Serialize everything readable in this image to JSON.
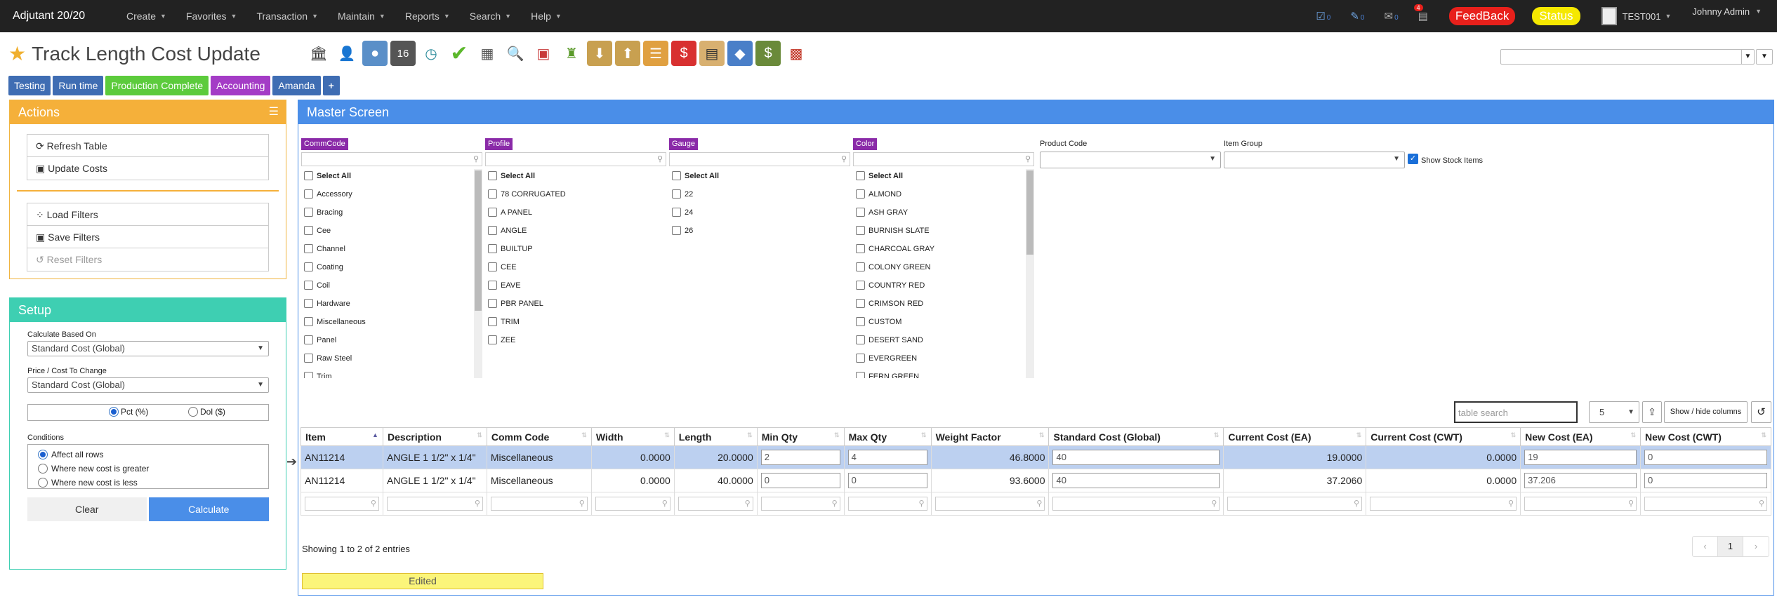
{
  "app": {
    "title": "Adjutant 20/20"
  },
  "topnav": {
    "menus": [
      "Create",
      "Favorites",
      "Transaction",
      "Maintain",
      "Reports",
      "Search",
      "Help"
    ],
    "tasks_count": "0",
    "edits_count": "0",
    "mail_count": "0",
    "alerts_badge": "4",
    "feedback_label": "FeedBack",
    "status_label": "Status",
    "company": "TEST001",
    "user": "Johnny Admin"
  },
  "page": {
    "title": "Track Length Cost Update"
  },
  "tabs": [
    {
      "label": "Testing",
      "color": "#3f6db3"
    },
    {
      "label": "Run time",
      "color": "#3f6db3"
    },
    {
      "label": "Production Complete",
      "color": "#5ccb3c"
    },
    {
      "label": "Accounting",
      "color": "#a43cc6"
    },
    {
      "label": "Amanda",
      "color": "#3f6db3"
    },
    {
      "label": "+",
      "color": "#3f6db3"
    }
  ],
  "actions": {
    "title": "Actions",
    "buttons": [
      "Refresh Table",
      "Update Costs"
    ],
    "filter_buttons": [
      "Load Filters",
      "Save Filters",
      "Reset Filters"
    ]
  },
  "setup": {
    "title": "Setup",
    "calc_label": "Calculate Based On",
    "calc_value": "Standard Cost (Global)",
    "price_label": "Price / Cost To Change",
    "price_value": "Standard Cost (Global)",
    "pct_label": "Pct (%)",
    "dol_label": "Dol ($)",
    "conditions_label": "Conditions",
    "conditions": [
      "Affect all rows",
      "Where new cost is greater",
      "Where new cost is less"
    ],
    "clear_label": "Clear",
    "calculate_label": "Calculate"
  },
  "master": {
    "title": "Master Screen",
    "filters": [
      {
        "label": "CommCode",
        "items": [
          "Select All",
          "Accessory",
          "Bracing",
          "Cee",
          "Channel",
          "Coating",
          "Coil",
          "Hardware",
          "Miscellaneous",
          "Panel",
          "Raw Steel",
          "Trim"
        ]
      },
      {
        "label": "Profile",
        "items": [
          "Select All",
          "78 CORRUGATED",
          "A PANEL",
          "ANGLE",
          "BUILTUP",
          "CEE",
          "EAVE",
          "PBR PANEL",
          "TRIM",
          "ZEE"
        ]
      },
      {
        "label": "Gauge",
        "items": [
          "Select All",
          "22",
          "24",
          "26"
        ]
      },
      {
        "label": "Color",
        "items": [
          "Select All",
          "ALMOND",
          "ASH GRAY",
          "BURNISH SLATE",
          "CHARCOAL GRAY",
          "COLONY GREEN",
          "COUNTRY RED",
          "CRIMSON RED",
          "CUSTOM",
          "DESERT SAND",
          "EVERGREEN",
          "FERN GREEN"
        ]
      }
    ],
    "product_code_label": "Product Code",
    "item_group_label": "Item Group",
    "show_stock_label": "Show Stock Items",
    "table_search_placeholder": "table search",
    "page_size": "5",
    "show_hide_label": "Show / hide columns",
    "columns": [
      "Item",
      "Description",
      "Comm Code",
      "Width",
      "Length",
      "Min Qty",
      "Max Qty",
      "Weight Factor",
      "Standard Cost (Global)",
      "Current Cost (EA)",
      "Current Cost (CWT)",
      "New Cost (EA)",
      "New Cost (CWT)"
    ],
    "rows": [
      {
        "item": "AN11214",
        "description": "ANGLE 1 1/2\" x 1/4\"",
        "comm_code": "Miscellaneous",
        "width": "0.0000",
        "length": "20.0000",
        "min_qty": "2",
        "max_qty": "4",
        "weight_factor": "46.8000",
        "std_cost": "40",
        "cur_ea": "19.0000",
        "cur_cwt": "0.0000",
        "new_ea": "19",
        "new_cwt": "0"
      },
      {
        "item": "AN11214",
        "description": "ANGLE 1 1/2\" x 1/4\"",
        "comm_code": "Miscellaneous",
        "width": "0.0000",
        "length": "40.0000",
        "min_qty": "0",
        "max_qty": "0",
        "weight_factor": "93.6000",
        "std_cost": "40",
        "cur_ea": "37.2060",
        "cur_cwt": "0.0000",
        "new_ea": "37.206",
        "new_cwt": "0"
      }
    ],
    "showing_text": "Showing 1 to 2 of 2 entries",
    "pagination": {
      "prev": "‹",
      "page": "1",
      "next": "›"
    },
    "edited_label": "Edited"
  }
}
